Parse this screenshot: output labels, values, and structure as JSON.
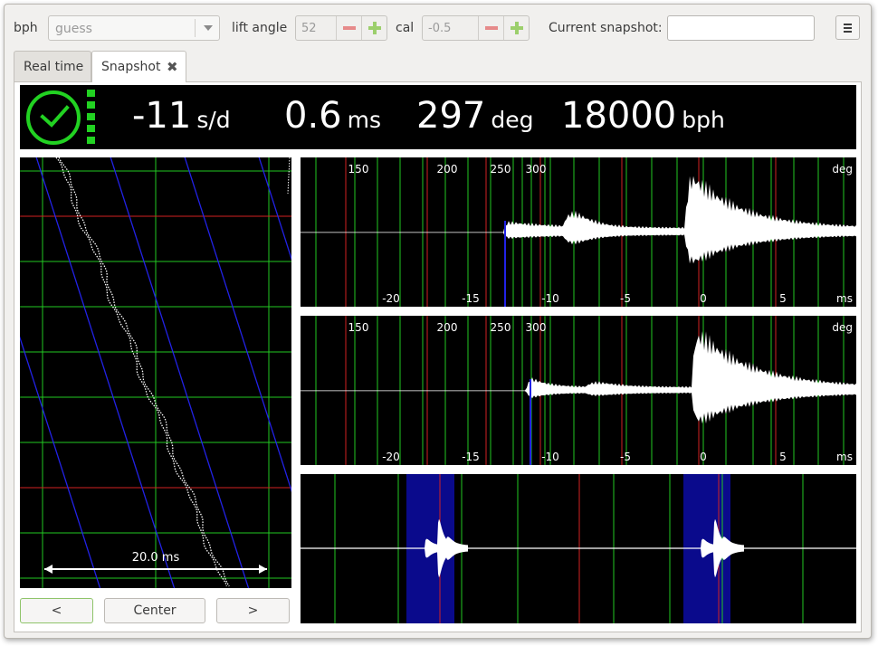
{
  "toolbar": {
    "bph_label": "bph",
    "bph_placeholder": "guess",
    "lift_angle_label": "lift angle",
    "lift_angle_value": "52",
    "cal_label": "cal",
    "cal_value": "-0.5",
    "snapshot_label": "Current snapshot:",
    "snapshot_value": ""
  },
  "tabs": [
    {
      "label": "Real time",
      "active": false
    },
    {
      "label": "Snapshot",
      "active": true
    }
  ],
  "status": {
    "rate_value": "-11",
    "rate_unit": "s/d",
    "beat_error_value": "0.6",
    "beat_error_unit": "ms",
    "amplitude_value": "297",
    "amplitude_unit": "deg",
    "bph_value": "18000",
    "bph_unit": "bph"
  },
  "paperstrip": {
    "scale_label": "20.0 ms"
  },
  "waveform_top": {
    "deg_ticks": [
      "150",
      "200",
      "250",
      "300"
    ],
    "deg_unit": "deg",
    "ms_ticks": [
      "-20",
      "-15",
      "-10",
      "-5",
      "0",
      "5"
    ],
    "ms_unit": "ms"
  },
  "waveform_bottom": {
    "deg_ticks": [
      "150",
      "200",
      "250",
      "300"
    ],
    "deg_unit": "deg",
    "ms_ticks": [
      "-20",
      "-15",
      "-10",
      "-5",
      "0",
      "5"
    ],
    "ms_unit": "ms"
  },
  "buttons": {
    "prev": "<",
    "center": "Center",
    "next": ">"
  },
  "colors": {
    "grid_green": "#22c822",
    "grid_red": "#d22222",
    "trace_blue": "#2222e6",
    "highlight_navy": "#0a0a8c",
    "status_ok": "#22d222"
  }
}
